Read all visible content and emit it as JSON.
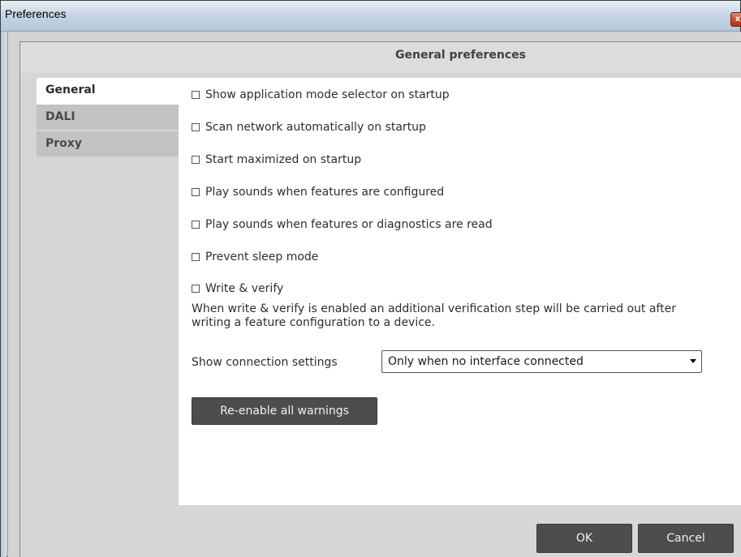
{
  "window": {
    "title": "Preferences",
    "close_glyph": "x"
  },
  "header": {
    "title": "General preferences"
  },
  "sidebar": {
    "items": [
      {
        "label": "General",
        "active": true
      },
      {
        "label": "DALI",
        "active": false
      },
      {
        "label": "Proxy",
        "active": false
      }
    ]
  },
  "options": [
    {
      "label": "Show application mode selector on startup",
      "checked": false
    },
    {
      "label": "Scan network automatically on startup",
      "checked": false
    },
    {
      "label": "Start maximized on startup",
      "checked": false
    },
    {
      "label": "Play sounds when features are configured",
      "checked": false
    },
    {
      "label": "Play sounds when features or diagnostics are read",
      "checked": false
    },
    {
      "label": "Prevent sleep mode",
      "checked": false
    },
    {
      "label": "Write & verify",
      "checked": false
    }
  ],
  "write_verify_description": "When write & verify is enabled an additional verification step will be carried out after writing a feature configuration to a device.",
  "connection": {
    "label": "Show connection settings",
    "selected": "Only when no interface connected"
  },
  "buttons": {
    "reenable": "Re-enable all warnings",
    "ok": "OK",
    "cancel": "Cancel"
  },
  "colors": {
    "button_dark": "#4d4d4d",
    "sidebar_inactive": "#c2c2c2",
    "panel": "#ffffff"
  }
}
